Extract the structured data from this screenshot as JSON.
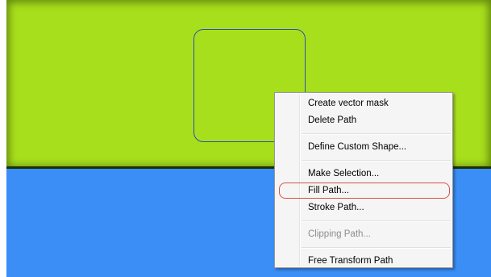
{
  "context_menu": {
    "items": [
      {
        "label": "Create vector mask",
        "enabled": true
      },
      {
        "label": "Delete Path",
        "enabled": true
      },
      {
        "label": "Define Custom Shape...",
        "enabled": true
      },
      {
        "label": "Make Selection...",
        "enabled": true
      },
      {
        "label": "Fill Path...",
        "enabled": true,
        "highlighted": true
      },
      {
        "label": "Stroke Path...",
        "enabled": true
      },
      {
        "label": "Clipping Path...",
        "enabled": false
      },
      {
        "label": "Free Transform Path",
        "enabled": true
      }
    ]
  },
  "colors": {
    "layer_fill": "#a8df1c",
    "background_fill": "#3a8ef6",
    "path_stroke": "#2c4fb8",
    "highlight_ring": "#d8504a"
  }
}
